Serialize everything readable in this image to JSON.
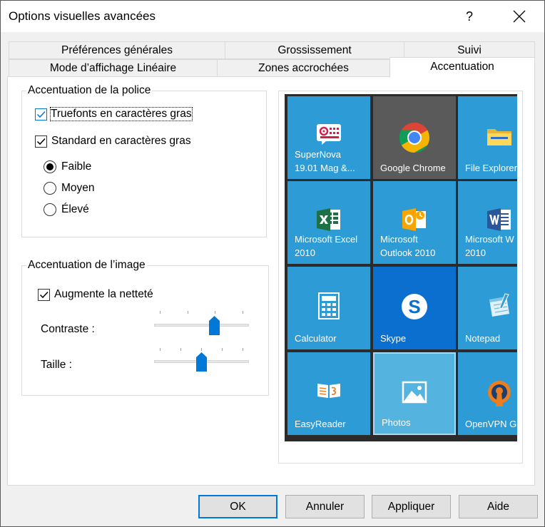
{
  "window": {
    "title": "Options visuelles avancées",
    "help_label": "?",
    "close_label": "✕"
  },
  "tabs": {
    "row1": [
      "Préférences générales",
      "Grossissement",
      "Suivi"
    ],
    "row2": [
      "Mode d’affichage Linéaire",
      "Zones accrochées",
      "Accentuation"
    ],
    "active": "Accentuation"
  },
  "font_group": {
    "title": "Accentuation de la police",
    "truefonts": {
      "label": "Truefonts en caractères gras",
      "checked": true
    },
    "standard": {
      "label": "Standard en caractères gras",
      "checked": true
    },
    "levels": [
      {
        "label": "Faible",
        "selected": true
      },
      {
        "label": "Moyen",
        "selected": false
      },
      {
        "label": "Élevé",
        "selected": false
      }
    ]
  },
  "image_group": {
    "title": "Accentuation de l’image",
    "sharpen": {
      "label": "Augmente la netteté",
      "checked": true
    },
    "contrast": {
      "label": "Contraste :",
      "value": 0.65
    },
    "size": {
      "label": "Taille :",
      "value": 0.5
    }
  },
  "preview": {
    "tiles": [
      {
        "label": "SuperNova\n19.01 Mag &...",
        "icon": "supernova-icon",
        "color": "#2d9bd6"
      },
      {
        "label": "Google Chrome",
        "icon": "chrome-icon",
        "color": "#5a5a5a"
      },
      {
        "label": "File Explorer",
        "icon": "folder-icon",
        "color": "#2d9bd6"
      },
      {
        "label": "Microsoft Excel\n2010",
        "icon": "excel-icon",
        "color": "#2d9bd6"
      },
      {
        "label": "Microsoft\nOutlook 2010",
        "icon": "outlook-icon",
        "color": "#2d9bd6"
      },
      {
        "label": "Microsoft W\n2010",
        "icon": "word-icon",
        "color": "#2d9bd6"
      },
      {
        "label": "Calculator",
        "icon": "calculator-icon",
        "color": "#2d9bd6"
      },
      {
        "label": "Skype",
        "icon": "skype-icon",
        "color": "#0a6fcf"
      },
      {
        "label": "Notepad",
        "icon": "notepad-icon",
        "color": "#2d9bd6"
      },
      {
        "label": "EasyReader",
        "icon": "easyreader-icon",
        "color": "#2d9bd6"
      },
      {
        "label": "Photos",
        "icon": "photos-icon",
        "color": "#55b3e0"
      },
      {
        "label": "OpenVPN G",
        "icon": "openvpn-icon",
        "color": "#2d9bd6"
      }
    ]
  },
  "buttons": {
    "ok": "OK",
    "cancel": "Annuler",
    "apply": "Appliquer",
    "help": "Aide"
  }
}
